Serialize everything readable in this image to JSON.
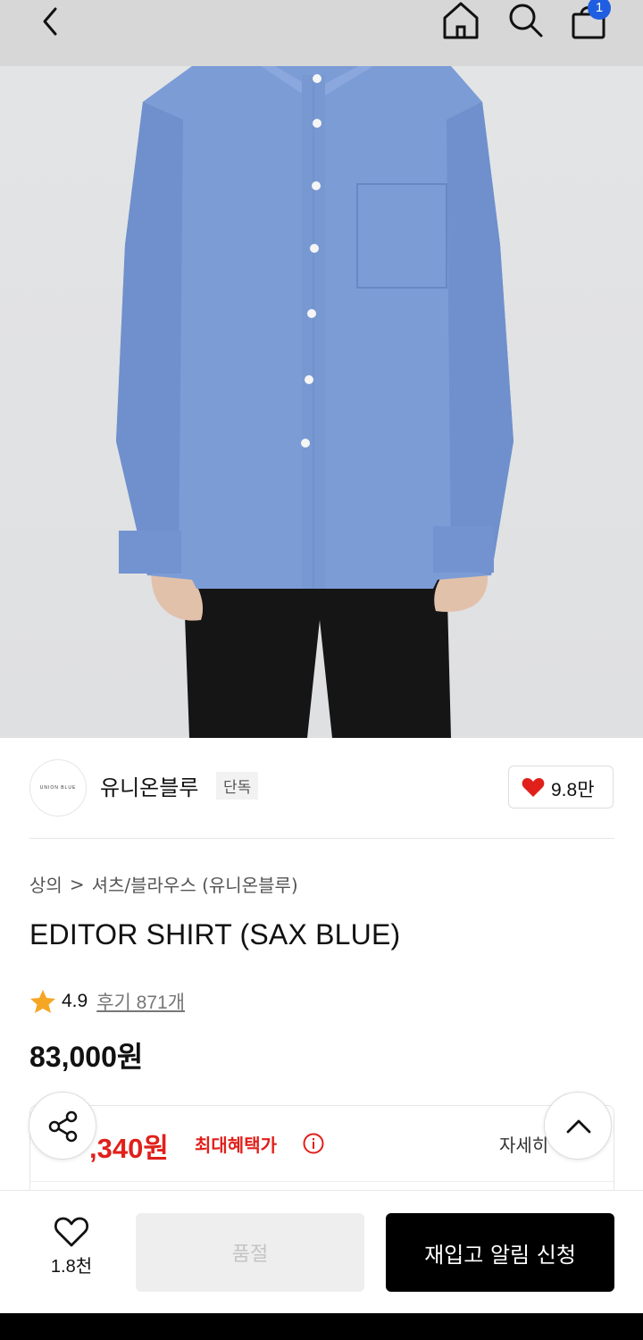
{
  "header": {
    "cart_count": "1"
  },
  "brand": {
    "logo_text": "UNION BLUE",
    "name": "유니온블루",
    "tag": "단독",
    "likes": "9.8만"
  },
  "breadcrumb": {
    "category": "상의",
    "separator": ">",
    "subcategory": "셔츠/블라우스 (유니온블루)"
  },
  "product": {
    "title": "EDITOR SHIRT (SAX BLUE)",
    "rating": "4.9",
    "reviews": "후기 871개",
    "price": "83,000원"
  },
  "benefit": {
    "price": ",340원",
    "label": "최대혜택가",
    "detail": "자세히"
  },
  "bottom": {
    "wish_count": "1.8천",
    "soldout_label": "품절",
    "restock_label": "재입고 알림 신청"
  },
  "colors": {
    "accent_red": "#e0201b",
    "badge_blue": "#1f5ee0",
    "shirt_blue": "#7c9cd6"
  }
}
